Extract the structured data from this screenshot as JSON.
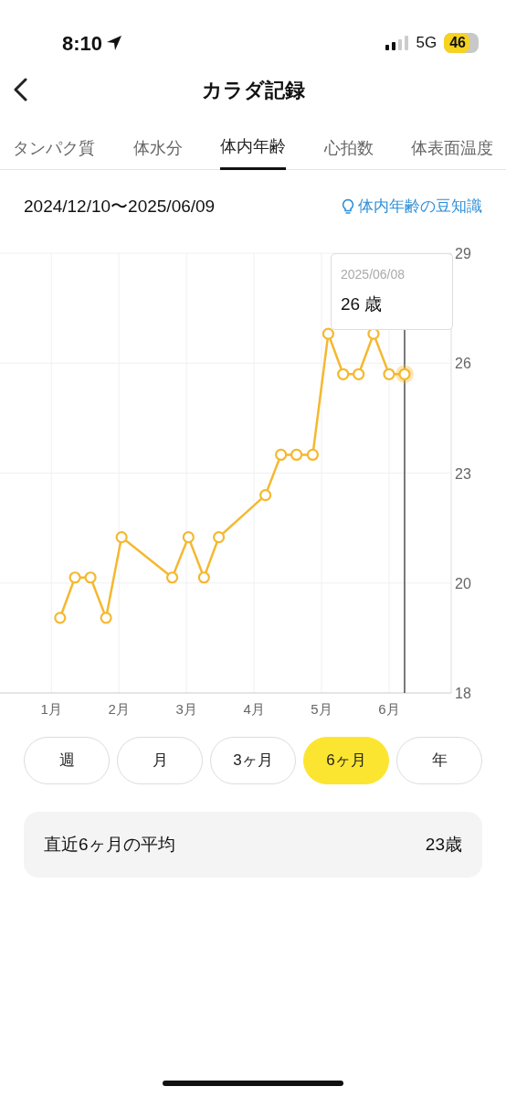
{
  "status_bar": {
    "time": "8:10",
    "network": "5G",
    "battery": "46"
  },
  "header": {
    "title": "カラダ記録"
  },
  "tabs": [
    {
      "label": "タンパク質",
      "selected": false
    },
    {
      "label": "体水分",
      "selected": false
    },
    {
      "label": "体内年齢",
      "selected": true
    },
    {
      "label": "心拍数",
      "selected": false
    },
    {
      "label": "体表面温度",
      "selected": false
    }
  ],
  "date_range": "2024/12/10〜2025/06/09",
  "tip_link": "体内年齢の豆知識",
  "chart": {
    "chart_data": {
      "type": "line",
      "x": [
        1.13,
        1.35,
        1.58,
        1.81,
        2.04,
        2.79,
        3.03,
        3.26,
        3.48,
        4.17,
        4.4,
        4.63,
        4.87,
        5.1,
        5.32,
        5.55,
        5.77,
        6,
        6.23
      ],
      "grid": true,
      "ref_lines": [
        {
          "axis": "x",
          "value": 6.23,
          "color": "#222222"
        }
      ],
      "series": [
        {
          "color": "#f5b82e",
          "marker": "o",
          "values": [
            19.05,
            20.15,
            20.15,
            19.05,
            21.25,
            20.15,
            21.25,
            20.15,
            21.25,
            22.4,
            23.5,
            23.5,
            23.5,
            26.8,
            25.7,
            25.7,
            26.8,
            25.7,
            25.7
          ]
        }
      ],
      "xlim": [
        0.24,
        6.92
      ],
      "ylim": [
        17,
        29
      ],
      "xticks": [
        {
          "value": 1,
          "label": "1月"
        },
        {
          "value": 2,
          "label": "2月"
        },
        {
          "value": 3,
          "label": "3月"
        },
        {
          "value": 4,
          "label": "4月"
        },
        {
          "value": 5,
          "label": "5月"
        },
        {
          "value": 6,
          "label": "6月"
        }
      ],
      "yticks": [
        20,
        23,
        26,
        29
      ]
    },
    "axis_bottom_label": "18",
    "tooltip": {
      "date": "2025/06/08",
      "value": "26 歳"
    }
  },
  "periods": [
    {
      "label": "週",
      "selected": false
    },
    {
      "label": "月",
      "selected": false
    },
    {
      "label": "3ヶ月",
      "selected": false
    },
    {
      "label": "6ヶ月",
      "selected": true
    },
    {
      "label": "年",
      "selected": false
    }
  ],
  "average": {
    "label": "直近6ヶ月の平均",
    "value": "23歳"
  }
}
